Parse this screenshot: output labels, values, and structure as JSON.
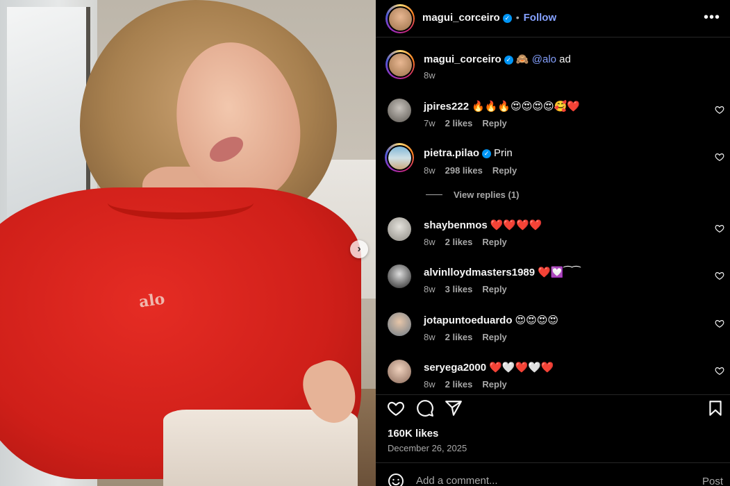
{
  "post": {
    "author": "magui_corceiro",
    "follow_label": "Follow",
    "separator": "•",
    "more_icon": "more-horizontal-icon",
    "image_logo_text": "alo",
    "next_icon": "chevron-right-icon"
  },
  "caption": {
    "username": "magui_corceiro",
    "emoji": "🙈",
    "mention": "@alo",
    "text": "ad",
    "time": "8w"
  },
  "comments": [
    {
      "username": "jpires222",
      "verified": false,
      "text": "🔥🔥🔥😍😍😍😍🥰❤️",
      "time": "7w",
      "likes": "2 likes",
      "reply": "Reply"
    },
    {
      "username": "pietra.pilao",
      "verified": true,
      "text": "Prin",
      "time": "8w",
      "likes": "298 likes",
      "reply": "Reply"
    },
    {
      "username": "shaybenmos",
      "verified": false,
      "text": "❤️❤️❤️❤️",
      "time": "8w",
      "likes": "2 likes",
      "reply": "Reply"
    },
    {
      "username": "alvinlloydmasters1989",
      "verified": false,
      "text": "❤️💟⁀⁀",
      "time": "8w",
      "likes": "3 likes",
      "reply": "Reply"
    },
    {
      "username": "jotapuntoeduardo",
      "verified": false,
      "text": "😍😍😍😍",
      "time": "8w",
      "likes": "2 likes",
      "reply": "Reply"
    },
    {
      "username": "seryega2000",
      "verified": false,
      "text": "❤️🤍❤️🤍❤️",
      "time": "8w",
      "likes": "2 likes",
      "reply": "Reply"
    }
  ],
  "view_replies": "View replies (1)",
  "likes_count": "160K likes",
  "date": "December 26, 2025",
  "add_comment": {
    "placeholder": "Add a comment...",
    "post_label": "Post"
  },
  "colors": {
    "background": "#000000",
    "link": "#85a1ff",
    "verified": "#0095f6",
    "muted": "#a8a8a8"
  }
}
